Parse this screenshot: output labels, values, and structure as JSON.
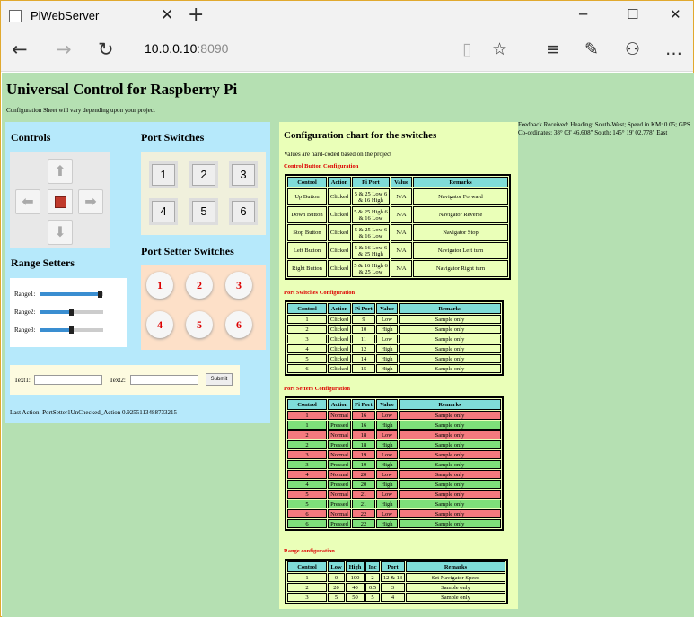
{
  "browser": {
    "tab_title": "PiWebServer",
    "url_host": "10.0.0.10",
    "url_port": ":8090"
  },
  "page": {
    "title": "Universal Control for Raspberry Pi",
    "subtitle": "Configuration Sheet will vary depending upon your project",
    "controls_heading": "Controls",
    "port_switches_heading": "Port Switches",
    "range_setters_heading": "Range Setters",
    "port_setter_heading": "Port Setter Switches",
    "port_switches": [
      "1",
      "2",
      "3",
      "4",
      "5",
      "6"
    ],
    "port_setters": [
      "1",
      "2",
      "3",
      "4",
      "5",
      "6"
    ],
    "ranges": [
      {
        "label": "Range1:",
        "value": 0.95
      },
      {
        "label": "Range2:",
        "value": 0.5
      },
      {
        "label": "Range3:",
        "value": 0.5
      }
    ],
    "text1_label": "Text1:",
    "text2_label": "Text2:",
    "submit_label": "Submit",
    "last_action": "Last Action: PortSetter1UnChecked_Action 0.9255113488733215",
    "feedback": "Feedback Received: Heading: South-West; Speed in KM: 0.05; GPS Co-ordinates: 38° 03' 46.608\" South; 145° 19' 02.778\" East"
  },
  "config": {
    "heading": "Configuration chart for the switches",
    "note": "Values are hard-coded based on the project",
    "control_section": "Control Button Configuration",
    "switch_section": "Port Switches Configuration",
    "setter_section": "Port Setters Configuration",
    "range_section": "Range configuration",
    "control_headers": [
      "Control",
      "Action",
      "Pi Port",
      "Value",
      "Remarks"
    ],
    "control_rows": [
      [
        "Up Button",
        "Clicked",
        "5 & 25 Low 6 & 16 High",
        "N/A",
        "Navigator Forward"
      ],
      [
        "Down Button",
        "Clicked",
        "5 & 25 High 6 & 16 Low",
        "N/A",
        "Navigator Reverse"
      ],
      [
        "Stop Button",
        "Clicked",
        "5 & 25 Low 6 & 16 Low",
        "N/A",
        "Navigator Stop"
      ],
      [
        "Left Button",
        "Clicked",
        "5 & 16 Low 6 & 25 High",
        "N/A",
        "Navigator Left turn"
      ],
      [
        "Right Button",
        "Clicked",
        "5 & 16 High 6 & 25 Low",
        "N/A",
        "Navigator Right turn"
      ]
    ],
    "switch_headers": [
      "Control",
      "Action",
      "Pi Port",
      "Value",
      "Remarks"
    ],
    "switch_rows": [
      [
        "1",
        "Clicked",
        "9",
        "Low",
        "Sample only"
      ],
      [
        "2",
        "Clicked",
        "10",
        "High",
        "Sample only"
      ],
      [
        "3",
        "Clicked",
        "11",
        "Low",
        "Sample only"
      ],
      [
        "4",
        "Clicked",
        "12",
        "High",
        "Sample only"
      ],
      [
        "5",
        "Clicked",
        "14",
        "High",
        "Sample only"
      ],
      [
        "6",
        "Clicked",
        "15",
        "High",
        "Sample only"
      ]
    ],
    "setter_headers": [
      "Control",
      "Action",
      "Pi Port",
      "Value",
      "Remarks"
    ],
    "setter_rows": [
      [
        "1",
        "Normal",
        "16",
        "Low",
        "Sample only"
      ],
      [
        "1",
        "Pressed",
        "16",
        "High",
        "Sample only"
      ],
      [
        "2",
        "Normal",
        "18",
        "Low",
        "Sample only"
      ],
      [
        "2",
        "Pressed",
        "18",
        "High",
        "Sample only"
      ],
      [
        "3",
        "Normal",
        "19",
        "Low",
        "Sample only"
      ],
      [
        "3",
        "Pressed",
        "19",
        "High",
        "Sample only"
      ],
      [
        "4",
        "Normal",
        "20",
        "Low",
        "Sample only"
      ],
      [
        "4",
        "Pressed",
        "20",
        "High",
        "Sample only"
      ],
      [
        "5",
        "Normal",
        "21",
        "Low",
        "Sample only"
      ],
      [
        "5",
        "Pressed",
        "21",
        "High",
        "Sample only"
      ],
      [
        "6",
        "Normal",
        "22",
        "Low",
        "Sample only"
      ],
      [
        "6",
        "Pressed",
        "22",
        "High",
        "Sample only"
      ]
    ],
    "range_headers": [
      "Control",
      "Low",
      "High",
      "Inc",
      "Port",
      "Remarks"
    ],
    "range_rows": [
      [
        "1",
        "0",
        "100",
        "2",
        "12 & 13",
        "Set Navigator Speed"
      ],
      [
        "2",
        "20",
        "40",
        "0.5",
        "3",
        "Sample only"
      ],
      [
        "3",
        "5",
        "50",
        "5",
        "4",
        "Sample only"
      ]
    ]
  },
  "colors": {
    "normal_row": "#f4797e",
    "pressed_row": "#7ee07a",
    "header": "#7fdcd8",
    "page_bg": "#b5e0b2"
  }
}
